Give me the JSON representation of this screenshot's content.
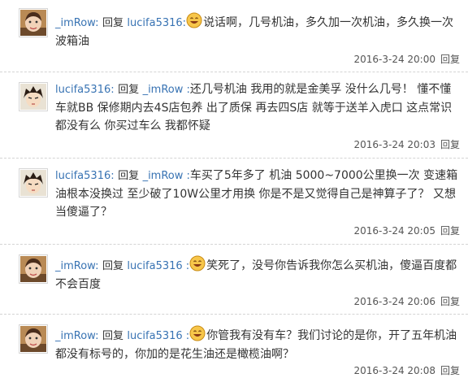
{
  "thread": {
    "reply_link_label": "回复",
    "colors": {
      "username": "#3873b3",
      "text": "#333333",
      "meta": "#555555"
    },
    "posts": [
      {
        "author": "_imRow",
        "separator": ":",
        "reply_word": "回复",
        "reply_to": "lucifa5316",
        "reply_to_separator": ":",
        "emoji": "laughing-face-emoji",
        "text": "说话啊，几号机油，多久加一次机油，多久换一次波箱油",
        "time": "2016-3-24 20:00"
      },
      {
        "author": "lucifa5316",
        "separator": ":",
        "reply_word": "回复",
        "reply_to": "_imRow",
        "reply_to_separator": " :",
        "emoji": "",
        "text": "还几号机油 我用的就是金美孚 没什么几号！ 懂不懂车就BB 保修期内去4S店包养 出了质保 再去四S店 就等于送羊入虎口 这点常识都没有么 你买过车么 我都怀疑",
        "time": "2016-3-24 20:03"
      },
      {
        "author": "lucifa5316",
        "separator": ":",
        "reply_word": "回复",
        "reply_to": "_imRow",
        "reply_to_separator": " :",
        "emoji": "",
        "text": "车买了5年多了 机油 5000~7000公里换一次 变速箱油根本没换过 至少破了10W公里才用换 你是不是又觉得自己是神算子了？ 又想当傻逼了？",
        "time": "2016-3-24 20:05"
      },
      {
        "author": "_imRow",
        "separator": ":",
        "reply_word": "回复",
        "reply_to": "lucifa5316",
        "reply_to_separator": " :",
        "emoji": "laughing-face-emoji",
        "text": "笑死了，没号你告诉我你怎么买机油，傻逼百度都不会百度",
        "time": "2016-3-24 20:06"
      },
      {
        "author": "_imRow",
        "separator": ":",
        "reply_word": "回复",
        "reply_to": "lucifa5316",
        "reply_to_separator": " :",
        "emoji": "laughing-face-emoji",
        "text": "你管我有没有车？我们讨论的是你，开了五年机油都没有标号的，你加的是花生油还是橄榄油啊？",
        "time": "2016-3-24 20:08"
      }
    ]
  }
}
